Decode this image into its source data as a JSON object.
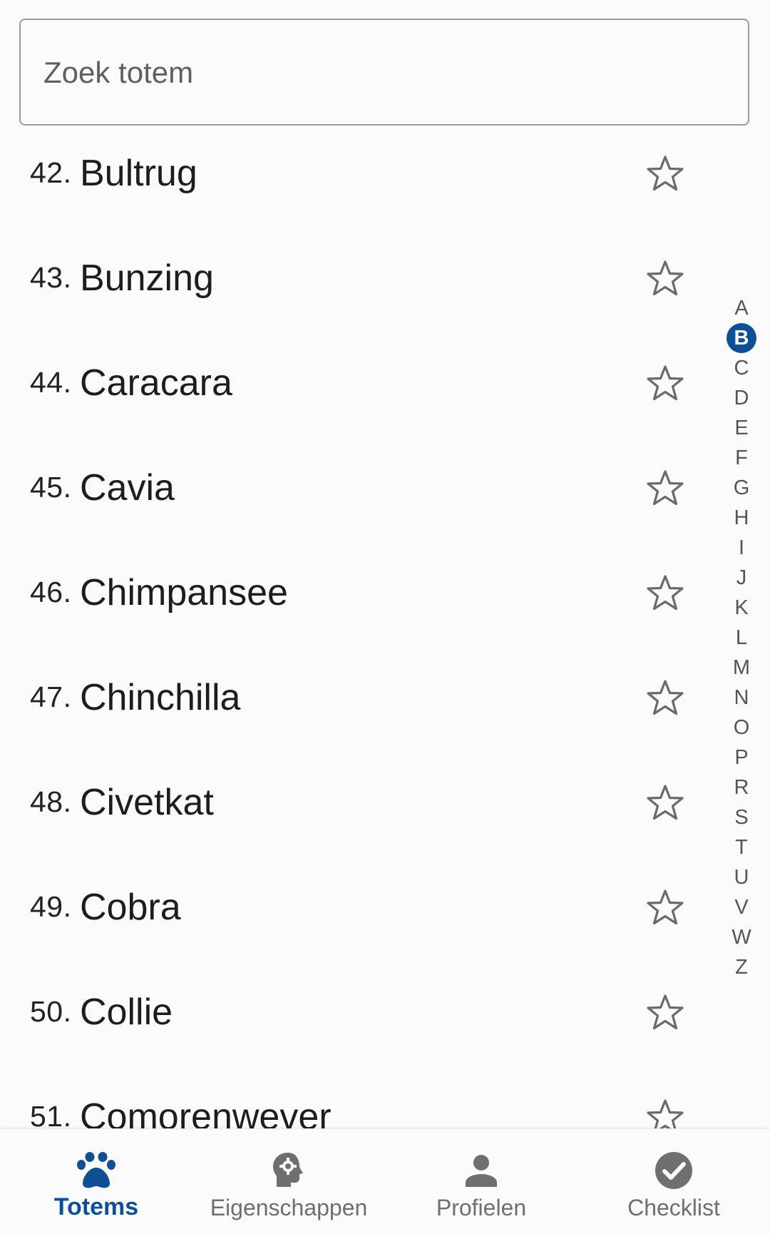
{
  "search": {
    "placeholder": "Zoek totem",
    "value": ""
  },
  "list": {
    "items": [
      {
        "number": "42.",
        "name": "Bultrug",
        "favorite": false
      },
      {
        "number": "43.",
        "name": "Bunzing",
        "favorite": false
      },
      {
        "number": "44.",
        "name": "Caracara",
        "favorite": false
      },
      {
        "number": "45.",
        "name": "Cavia",
        "favorite": false
      },
      {
        "number": "46.",
        "name": "Chimpansee",
        "favorite": false
      },
      {
        "number": "47.",
        "name": "Chinchilla",
        "favorite": false
      },
      {
        "number": "48.",
        "name": "Civetkat",
        "favorite": false
      },
      {
        "number": "49.",
        "name": "Cobra",
        "favorite": false
      },
      {
        "number": "50.",
        "name": "Collie",
        "favorite": false
      },
      {
        "number": "51.",
        "name": "Comorenwever",
        "favorite": false
      }
    ],
    "favorite_icon": "star-outline-icon"
  },
  "alphabet_index": {
    "letters": [
      "A",
      "B",
      "C",
      "D",
      "E",
      "F",
      "G",
      "H",
      "I",
      "J",
      "K",
      "L",
      "M",
      "N",
      "O",
      "P",
      "R",
      "S",
      "T",
      "U",
      "V",
      "W",
      "Z"
    ],
    "active": "B"
  },
  "bottom_nav": {
    "items": [
      {
        "label": "Totems",
        "icon": "paw-icon",
        "active": true
      },
      {
        "label": "Eigenschappen",
        "icon": "head-gear-icon",
        "active": false
      },
      {
        "label": "Profielen",
        "icon": "person-icon",
        "active": false
      },
      {
        "label": "Checklist",
        "icon": "check-circle-icon",
        "active": false
      }
    ]
  },
  "colors": {
    "accent": "#0f4f93",
    "background": "#fafafa",
    "inactive": "#6f6f6f",
    "star_outline": "#6a6a6a"
  }
}
